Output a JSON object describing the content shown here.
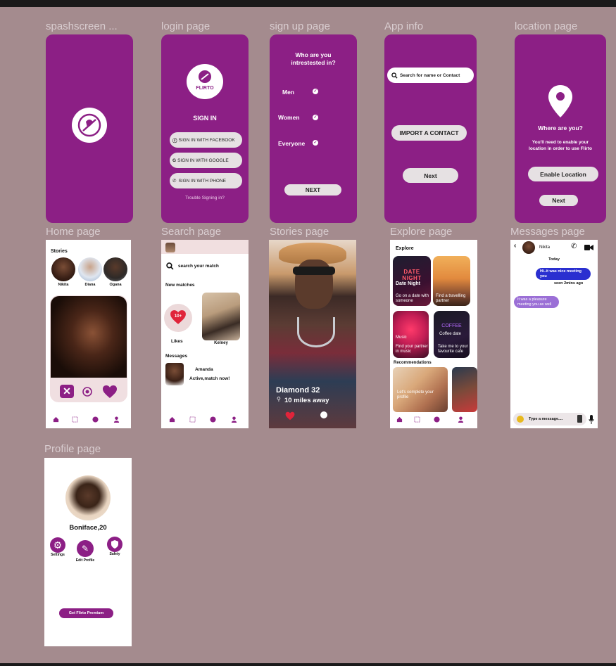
{
  "frames": {
    "splash": {
      "title": "spashscreen ..."
    },
    "login": {
      "title": "login page",
      "logo_text": "FLIRTO",
      "heading": "SIGN IN",
      "btn_facebook": "SIGN IN WITH FACEBOOK",
      "btn_google": "SIGN IN WITH GOOGLE",
      "btn_phone": "SIGN IN WITH PHONE",
      "trouble": "Trouble Signing in?"
    },
    "signup": {
      "title": "sign up page",
      "question": "Who are you intrestested in?",
      "options": [
        "Men",
        "Women",
        "Everyone"
      ],
      "next": "NEXT"
    },
    "appinfo": {
      "title": "App info",
      "search_placeholder": "Search for name or Contact",
      "import": "IMPORT A CONTACT",
      "next": "Next"
    },
    "location": {
      "title": "location page",
      "question": "Where are you?",
      "desc": "You'll need to enable your location in order to use Flirto",
      "enable": "Enable Location",
      "next": "Next"
    },
    "home": {
      "title": "Home page",
      "stories_label": "Stories",
      "stories": [
        "Nikita",
        "Diana",
        "Ogana"
      ]
    },
    "search": {
      "title": "Search page",
      "search_text": "search your match",
      "new_matches": "New matches",
      "likes_badge": "10+",
      "likes": "Likes",
      "match_name": "Kelney",
      "messages": "Messages",
      "msg_name": "Amanda",
      "msg_text": "Active,match now!"
    },
    "stories": {
      "title": "Stories page",
      "name": "Diamond 32",
      "distance": "10 miles away"
    },
    "explore": {
      "title": "Explore page",
      "heading": "Explore",
      "tiles": [
        {
          "big": "DATE NIGHT",
          "title": "Date Night",
          "sub": "Go on a date with someone"
        },
        {
          "big": "",
          "title": "",
          "sub": "Find a travelling partner"
        },
        {
          "big": "",
          "title": "Music",
          "sub": "Find your partner in music"
        },
        {
          "big": "COFFEE",
          "title": "Coffee date",
          "sub": "Take me to your favourite cafe"
        }
      ],
      "recommendations": "Recommendations",
      "rec_tile": "Let's complete your profile"
    },
    "messages": {
      "title": "Messages page",
      "contact": "Nikita",
      "today": "Today",
      "sent": "Hi..it was nice meeting you",
      "seen": "seen  2mins ago",
      "received": "It was a pleasure meeting you as well",
      "input_placeholder": "Type a message...."
    },
    "profile": {
      "title": "Profile page",
      "name": "Boniface,20",
      "settings": "Settings",
      "edit": "Edit Profile",
      "safety": "Safety",
      "premium": "Get Flirto Premium"
    }
  },
  "colors": {
    "brand_purple": "#8c1f85",
    "background": "#a48b8e",
    "sent_bubble": "#2a2fd0",
    "received_bubble": "#9b6fd6"
  },
  "icons": [
    "flirto-logo-icon",
    "facebook-icon",
    "google-icon",
    "phone-icon",
    "check-icon",
    "search-icon",
    "location-pin-icon",
    "heart-icon",
    "close-icon",
    "target-icon",
    "home-icon",
    "grid-icon",
    "messenger-icon",
    "user-icon",
    "back-icon",
    "call-icon",
    "video-icon",
    "emoji-icon",
    "attach-icon",
    "mic-icon",
    "gear-icon",
    "pencil-icon",
    "shield-icon"
  ]
}
